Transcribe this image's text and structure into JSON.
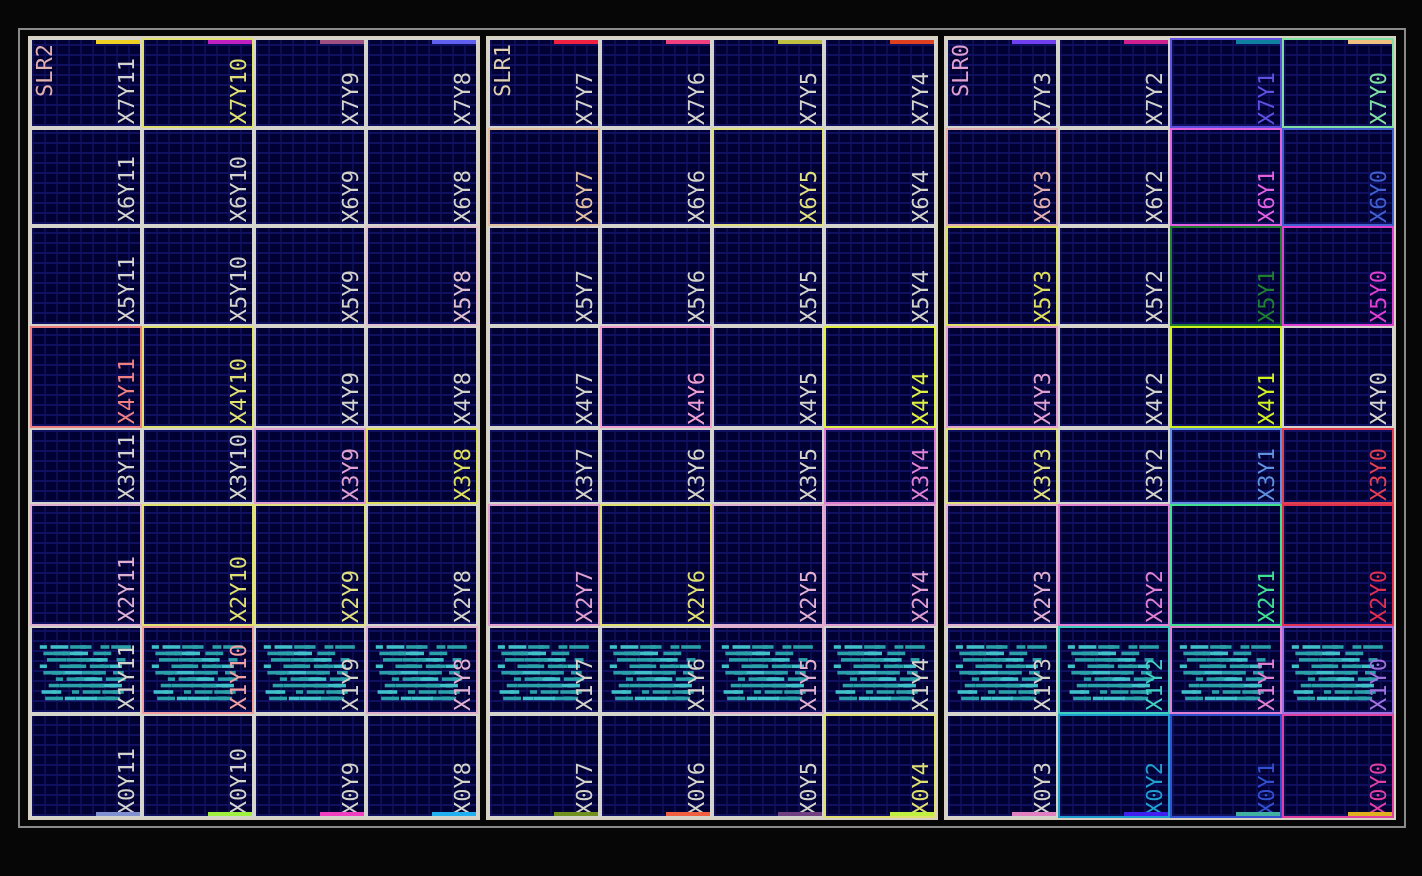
{
  "slrs": [
    {
      "slr": {
        "label": "SLR2",
        "color": "#e0b0b0"
      },
      "top_markers": [
        {
          "color": "#f0d020"
        },
        {
          "color": "#c020c0"
        },
        {
          "color": "#a05080"
        },
        {
          "color": "#6060f0"
        }
      ],
      "bottom_markers": [
        {
          "color": "#8090d0"
        },
        {
          "color": "#a0f040"
        },
        {
          "color": "#f040c0"
        },
        {
          "color": "#20b0f0"
        }
      ],
      "rows": [
        [
          {
            "label": "X7Y11",
            "utilized": false
          },
          {
            "label": "X7Y10",
            "color": "#e0e070",
            "utilized": false
          },
          {
            "label": "X7Y9",
            "utilized": false
          },
          {
            "label": "X7Y8",
            "utilized": false
          }
        ],
        [
          {
            "label": "X6Y11",
            "utilized": false
          },
          {
            "label": "X6Y10",
            "utilized": false
          },
          {
            "label": "X6Y9",
            "utilized": false
          },
          {
            "label": "X6Y8",
            "utilized": false
          }
        ],
        [
          {
            "label": "X5Y11",
            "utilized": false
          },
          {
            "label": "X5Y10",
            "utilized": false
          },
          {
            "label": "X5Y9",
            "utilized": false
          },
          {
            "label": "X5Y8",
            "color": "#e0c0d0",
            "utilized": false
          }
        ],
        [
          {
            "label": "X4Y11",
            "color": "#f08080",
            "utilized": false
          },
          {
            "label": "X4Y10",
            "color": "#e0e070",
            "utilized": false
          },
          {
            "label": "X4Y9",
            "utilized": false
          },
          {
            "label": "X4Y8",
            "utilized": false
          }
        ],
        [
          {
            "label": "X3Y11",
            "utilized": false
          },
          {
            "label": "X3Y10",
            "utilized": false
          },
          {
            "label": "X3Y9",
            "color": "#e0a0d0",
            "utilized": false
          },
          {
            "label": "X3Y8",
            "color": "#e0e060",
            "utilized": false
          }
        ],
        [
          {
            "label": "X2Y11",
            "color": "#e0b0d0",
            "utilized": false
          },
          {
            "label": "X2Y10",
            "color": "#e0e070",
            "utilized": false
          },
          {
            "label": "X2Y9",
            "color": "#e0e080",
            "utilized": false
          },
          {
            "label": "X2Y8",
            "utilized": false
          }
        ],
        [
          {
            "label": "X1Y11",
            "utilized": true
          },
          {
            "label": "X1Y10",
            "color": "#f0a0a0",
            "utilized": true
          },
          {
            "label": "X1Y9",
            "utilized": true
          },
          {
            "label": "X1Y8",
            "color": "#e0b0d0",
            "utilized": true
          }
        ],
        [
          {
            "label": "X0Y11",
            "utilized": false
          },
          {
            "label": "X0Y10",
            "utilized": false
          },
          {
            "label": "X0Y9",
            "utilized": false
          },
          {
            "label": "X0Y8",
            "utilized": false
          }
        ]
      ]
    },
    {
      "slr": {
        "label": "SLR1",
        "color": "#e0d0b0"
      },
      "top_markers": [
        {
          "color": "#f02040"
        },
        {
          "color": "#f04080"
        },
        {
          "color": "#c0c040"
        },
        {
          "color": "#e04020"
        }
      ],
      "bottom_markers": [
        {
          "color": "#709020"
        },
        {
          "color": "#f06040"
        },
        {
          "color": "#704080"
        },
        {
          "color": "#c0f040"
        }
      ],
      "rows": [
        [
          {
            "label": "X7Y7",
            "utilized": false
          },
          {
            "label": "X7Y6",
            "utilized": false
          },
          {
            "label": "X7Y5",
            "utilized": false
          },
          {
            "label": "X7Y4",
            "utilized": false
          }
        ],
        [
          {
            "label": "X6Y7",
            "color": "#e0c0a0",
            "utilized": false
          },
          {
            "label": "X6Y6",
            "utilized": false
          },
          {
            "label": "X6Y5",
            "color": "#e0e080",
            "utilized": false
          },
          {
            "label": "X6Y4",
            "utilized": false
          }
        ],
        [
          {
            "label": "X5Y7",
            "utilized": false
          },
          {
            "label": "X5Y6",
            "utilized": false
          },
          {
            "label": "X5Y5",
            "utilized": false
          },
          {
            "label": "X5Y4",
            "utilized": false
          }
        ],
        [
          {
            "label": "X4Y7",
            "utilized": false
          },
          {
            "label": "X4Y6",
            "color": "#f0a0d0",
            "utilized": false
          },
          {
            "label": "X4Y5",
            "utilized": false
          },
          {
            "label": "X4Y4",
            "color": "#e0f040",
            "utilized": false
          }
        ],
        [
          {
            "label": "X3Y7",
            "utilized": false
          },
          {
            "label": "X3Y6",
            "utilized": false
          },
          {
            "label": "X3Y5",
            "utilized": false
          },
          {
            "label": "X3Y4",
            "color": "#e080d0",
            "utilized": false
          }
        ],
        [
          {
            "label": "X2Y7",
            "color": "#e0a0d0",
            "utilized": false
          },
          {
            "label": "X2Y6",
            "color": "#e0e070",
            "utilized": false
          },
          {
            "label": "X2Y5",
            "color": "#e0b0d0",
            "utilized": false
          },
          {
            "label": "X2Y4",
            "color": "#e0a0d0",
            "utilized": false
          }
        ],
        [
          {
            "label": "X1Y7",
            "utilized": true
          },
          {
            "label": "X1Y6",
            "utilized": true
          },
          {
            "label": "X1Y5",
            "color": "#e0b0d0",
            "utilized": true
          },
          {
            "label": "X1Y4",
            "utilized": true
          }
        ],
        [
          {
            "label": "X0Y7",
            "utilized": false
          },
          {
            "label": "X0Y6",
            "utilized": false
          },
          {
            "label": "X0Y5",
            "utilized": false
          },
          {
            "label": "X0Y4",
            "color": "#e0e070",
            "utilized": false
          }
        ]
      ]
    },
    {
      "slr": {
        "label": "SLR0",
        "color": "#e0a0d0"
      },
      "top_markers": [
        {
          "color": "#7040f0"
        },
        {
          "color": "#d02090"
        },
        {
          "color": "#1080a0"
        },
        {
          "color": "#f0c080"
        }
      ],
      "bottom_markers": [
        {
          "color": "#e080c0"
        },
        {
          "color": "#4020f0"
        },
        {
          "color": "#40b0a0"
        },
        {
          "color": "#e0b020"
        }
      ],
      "rows": [
        [
          {
            "label": "X7Y3",
            "utilized": false
          },
          {
            "label": "X7Y2",
            "utilized": false
          },
          {
            "label": "X7Y1",
            "color": "#6050e0",
            "utilized": false
          },
          {
            "label": "X7Y0",
            "color": "#80e0a0",
            "utilized": false
          }
        ],
        [
          {
            "label": "X6Y3",
            "color": "#e0b0b0",
            "utilized": false
          },
          {
            "label": "X6Y2",
            "utilized": false
          },
          {
            "label": "X6Y1",
            "color": "#e060e0",
            "utilized": false
          },
          {
            "label": "X6Y0",
            "color": "#4060d0",
            "utilized": false
          }
        ],
        [
          {
            "label": "X5Y3",
            "color": "#e0e060",
            "utilized": false
          },
          {
            "label": "X5Y2",
            "utilized": false
          },
          {
            "label": "X5Y1",
            "color": "#208030",
            "utilized": false
          },
          {
            "label": "X5Y0",
            "color": "#e040d0",
            "utilized": false
          }
        ],
        [
          {
            "label": "X4Y3",
            "color": "#e0a0d0",
            "utilized": false
          },
          {
            "label": "X4Y2",
            "utilized": false
          },
          {
            "label": "X4Y1",
            "color": "#d0f020",
            "utilized": false
          },
          {
            "label": "X4Y0",
            "utilized": false
          }
        ],
        [
          {
            "label": "X3Y3",
            "color": "#e0e080",
            "utilized": false
          },
          {
            "label": "X3Y2",
            "utilized": false
          },
          {
            "label": "X3Y1",
            "color": "#6090e0",
            "utilized": false
          },
          {
            "label": "X3Y0",
            "color": "#e04050",
            "utilized": false
          }
        ],
        [
          {
            "label": "X2Y3",
            "color": "#e0b0d0",
            "utilized": false
          },
          {
            "label": "X2Y2",
            "color": "#e080d0",
            "utilized": false
          },
          {
            "label": "X2Y1",
            "color": "#40e090",
            "utilized": false
          },
          {
            "label": "X2Y0",
            "color": "#e03050",
            "utilized": false
          }
        ],
        [
          {
            "label": "X1Y3",
            "utilized": true
          },
          {
            "label": "X1Y2",
            "color": "#40d0c0",
            "utilized": true
          },
          {
            "label": "X1Y1",
            "color": "#e080d0",
            "utilized": true
          },
          {
            "label": "X1Y0",
            "color": "#a070e0",
            "utilized": true
          }
        ],
        [
          {
            "label": "X0Y3",
            "utilized": false
          },
          {
            "label": "X0Y2",
            "color": "#20a0d0",
            "utilized": false
          },
          {
            "label": "X0Y1",
            "color": "#3050d0",
            "utilized": false
          },
          {
            "label": "X0Y0",
            "color": "#e040a0",
            "utilized": false
          }
        ]
      ]
    }
  ]
}
